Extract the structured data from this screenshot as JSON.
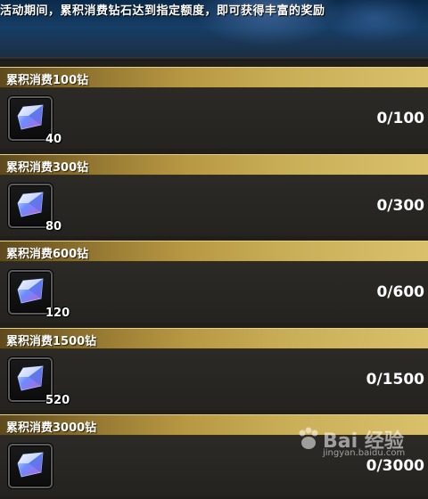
{
  "banner": {
    "text": "活动期间，累积消费钻石达到指定额度，即可获得丰富的奖励"
  },
  "tiers": [
    {
      "title": "累积消费100钻",
      "reward_count": "40",
      "progress": "0/100"
    },
    {
      "title": "累积消费300钻",
      "reward_count": "80",
      "progress": "0/300"
    },
    {
      "title": "累积消费600钻",
      "reward_count": "120",
      "progress": "0/600"
    },
    {
      "title": "累积消费1500钻",
      "reward_count": "520",
      "progress": "0/1500"
    },
    {
      "title": "累积消费3000钻",
      "reward_count": "",
      "progress": "0/3000"
    }
  ],
  "reward_icon": "crystal-icon",
  "watermark": {
    "brand": "Bai 经验",
    "url": "jingyan.baidu.com"
  },
  "colors": {
    "header_gold": "#cbb05a",
    "crystal_blue": "#6b8cff",
    "crystal_purple": "#c25bd6"
  }
}
